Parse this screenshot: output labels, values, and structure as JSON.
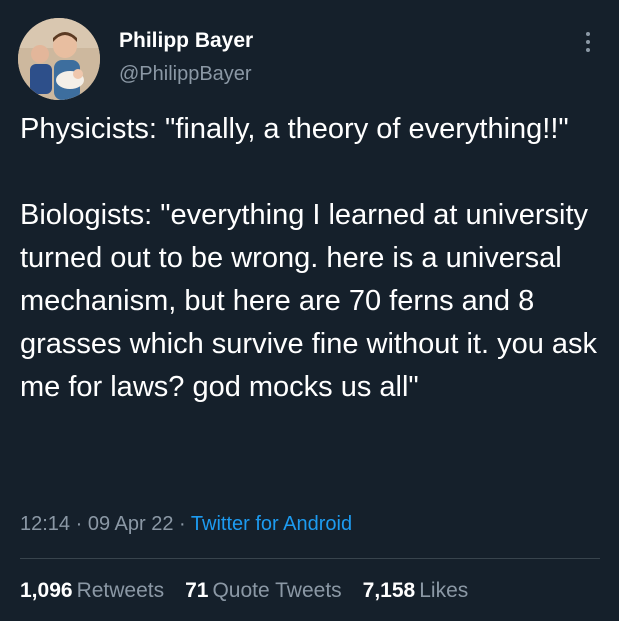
{
  "author": {
    "name": "Philipp Bayer",
    "handle": "@PhilippBayer"
  },
  "tweet": {
    "text": "Physicists: \"finally, a theory of everything!!\"\n\nBiologists: \"everything I learned at university turned out to be wrong. here is a universal mechanism, but here are 70 ferns and 8 grasses which survive fine without it. you ask me for laws? god mocks us all\"",
    "time": "12:14",
    "separator": "·",
    "date": "09 Apr 22",
    "source": "Twitter for Android"
  },
  "stats": {
    "retweets_count": "1,096",
    "retweets_label": "Retweets",
    "quotes_count": "71",
    "quotes_label": "Quote Tweets",
    "likes_count": "7,158",
    "likes_label": "Likes"
  },
  "colors": {
    "background": "#15202b",
    "primary_text": "#ffffff",
    "secondary_text": "#8b98a5",
    "link": "#1d9bf0",
    "divider": "#38444d"
  },
  "icons": {
    "more": "more-options-icon"
  }
}
